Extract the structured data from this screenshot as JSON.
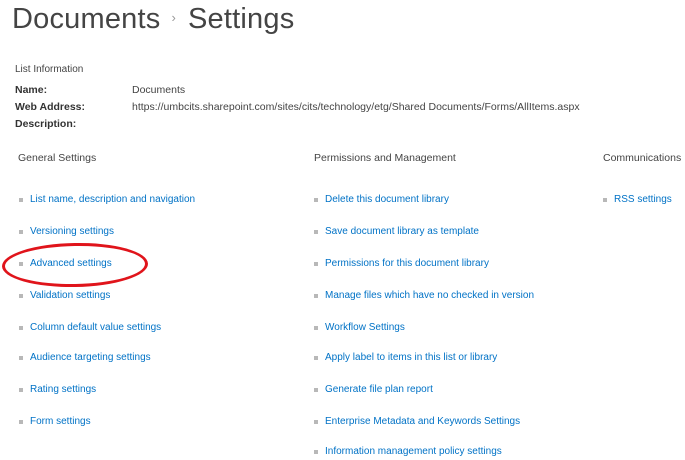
{
  "header": {
    "breadcrumb_parent": "Documents",
    "breadcrumb_separator": "›",
    "breadcrumb_current": "Settings"
  },
  "list_info": {
    "heading": "List Information",
    "name_label": "Name:",
    "name_value": "Documents",
    "web_address_label": "Web Address:",
    "web_address_value": "https://umbcits.sharepoint.com/sites/cits/technology/etg/Shared Documents/Forms/AllItems.aspx",
    "description_label": "Description:",
    "description_value": ""
  },
  "general_settings": {
    "heading": "General Settings",
    "items": [
      "List name, description and navigation",
      "Versioning settings",
      "Advanced settings",
      "Validation settings",
      "Column default value settings",
      "Audience targeting settings",
      "Rating settings",
      "Form settings"
    ]
  },
  "permissions": {
    "heading": "Permissions and Management",
    "items": [
      "Delete this document library",
      "Save document library as template",
      "Permissions for this document library",
      "Manage files which have no checked in version",
      "Workflow Settings",
      "Apply label to items in this list or library",
      "Generate file plan report",
      "Enterprise Metadata and Keywords Settings",
      "Information management policy settings"
    ]
  },
  "communications": {
    "heading": "Communications",
    "items": [
      "RSS settings"
    ]
  },
  "colors": {
    "link": "#0072c6",
    "highlight_circle": "#e0141b",
    "text": "#444444"
  }
}
